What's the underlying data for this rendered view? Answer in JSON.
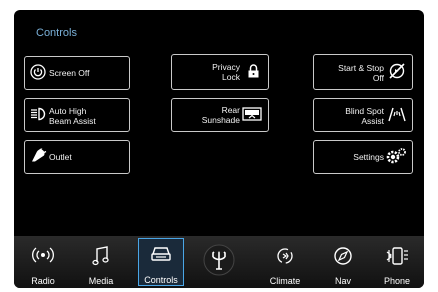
{
  "title": "Controls",
  "buttons": {
    "screen_off": "Screen Off",
    "privacy_lock": [
      "Privacy",
      "Lock"
    ],
    "start_stop": [
      "Start & Stop",
      "Off"
    ],
    "auto_high_beam": [
      "Auto High",
      "Beam Assist"
    ],
    "rear_sunshade": [
      "Rear",
      "Sunshade"
    ],
    "blind_spot": [
      "Blind Spot",
      "Assist"
    ],
    "outlet": "Outlet",
    "settings": "Settings"
  },
  "nav": {
    "radio": "Radio",
    "media": "Media",
    "controls": "Controls",
    "climate": "Climate",
    "nav": "Nav",
    "phone": "Phone"
  },
  "colors": {
    "accent": "#4aa6e6",
    "title": "#7ab0d8"
  }
}
